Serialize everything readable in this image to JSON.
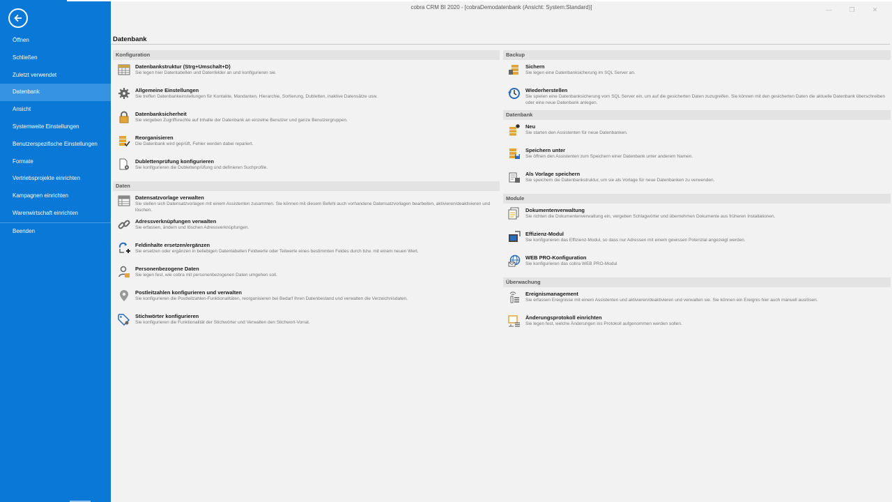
{
  "window": {
    "title": "cobra CRM BI 2020 - [cobraDemodatenbank (Ansicht: System:Standard)]",
    "controls": [
      "—",
      "❐",
      "✕"
    ]
  },
  "sidebar": {
    "items": [
      {
        "label": "Öffnen"
      },
      {
        "label": "Schließen"
      },
      {
        "label": "Zuletzt verwendet"
      },
      {
        "label": "Datenbank"
      },
      {
        "label": "Ansicht"
      },
      {
        "label": "Systemweite Einstellungen"
      },
      {
        "label": "Benutzerspezifische Einstellungen"
      },
      {
        "label": "Formate"
      },
      {
        "label": "Vertriebsprojekte einrichten"
      },
      {
        "label": "Kampagnen einrichten"
      },
      {
        "label": "Warenwirtschaft einrichten"
      },
      {
        "label": "Beenden"
      }
    ]
  },
  "page": {
    "title": "Datenbank"
  },
  "left": {
    "konfiguration": {
      "heading": "Konfiguration",
      "items": [
        {
          "title": "Datenbankstruktur (Strg+Umschalt+D)",
          "desc": "Sie legen hier Datentabellen und Datenfelder an und konfigurieren sie."
        },
        {
          "title": "Allgemeine Einstellungen",
          "desc": "Sie treffen Datenbankeinstellungen für Kontakte, Mandanten, Hierarchie, Sortierung, Dubletten, inaktive Datensätze usw."
        },
        {
          "title": "Datenbanksicherheit",
          "desc": "Sie vergeben Zugriffsrechte auf Inhalte der Datenbank an einzelne Benutzer und ganze Benutzergruppen."
        },
        {
          "title": "Reorganisieren",
          "desc": "Die Datenbank wird geprüft, Fehler werden dabei repariert."
        },
        {
          "title": "Dublettenprüfung konfigurieren",
          "desc": "Sie konfigurieren die Dublettenprüfung und definieren Suchprofile."
        }
      ]
    },
    "daten": {
      "heading": "Daten",
      "items": [
        {
          "title": "Datensatzvorlage verwalten",
          "desc": "Sie stellen sich Datensatzvorlagen mit einem Assistenten zusammen. Sie können mit diesem Befehl auch vorhandene Datensatzvorlagen bearbeiten, aktivieren/deaktivieren und löschen."
        },
        {
          "title": "Adressverknüpfungen verwalten",
          "desc": "Sie erfassen, ändern und löschen Adressverknüpfungen."
        },
        {
          "title": "Feldinhalte ersetzen/ergänzen",
          "desc": "Sie ersetzen oder ergänzen in beliebigen Datentabellen Feldwerte oder Teilwerte eines bestimmten Feldes durch bzw. mit einem neuen Wert."
        },
        {
          "title": "Personenbezogene Daten",
          "desc": "Sie legen fest, wie cobra mit personenbezogenen Daten umgehen soll."
        },
        {
          "title": "Postleitzahlen konfigurieren und verwalten",
          "desc": "Sie konfigurieren die Postleitzahlen-Funktionalitäten, reorganisieren bei Bedarf Ihren Datenbestand und verwalten die Verzeichnisdaten."
        },
        {
          "title": "Stichwörter konfigurieren",
          "desc": "Sie konfigurieren die Funktionalität der Stichwörter und Verwalten den Stichwort-Vorrat."
        }
      ]
    }
  },
  "right": {
    "backup": {
      "heading": "Backup",
      "items": [
        {
          "title": "Sichern",
          "desc": "Sie legen eine Datenbanksicherung im SQL Server an."
        },
        {
          "title": "Wiederherstellen",
          "desc": "Sie spielen eine Datenbanksicherung vom SQL Server ein, um auf die gesicherten Daten zuzugreifen. Sie können mit den gesicherten Daten die aktuelle Datenbank überschreiben oder eine neue Datenbank anlegen."
        }
      ]
    },
    "datenbank": {
      "heading": "Datenbank",
      "items": [
        {
          "title": "Neu",
          "desc": "Sie starten den Assistenten für neue Datenbanken."
        },
        {
          "title": "Speichern unter",
          "desc": "Sie öffnen den Assistenten zum Speichern einer Datenbank unter anderem Namen."
        },
        {
          "title": "Als Vorlage speichern",
          "desc": "Sie speichern die Datenbankstruktur, um sie als Vorlage für neue Datenbanken zu verwenden."
        }
      ]
    },
    "module": {
      "heading": "Module",
      "items": [
        {
          "title": "Dokumentenverwaltung",
          "desc": "Sie richten die Dokumentenverwaltung ein, vergeben Schlagwörter und übernehmen Dokumente aus früheren Installationen."
        },
        {
          "title": "Effizienz-Modul",
          "desc": "Sie konfigurieren das Effizienz-Modul, so dass nur Adressen mit einem gewissen Potenzial angezeigt werden."
        },
        {
          "title": "WEB PRO-Konfiguration",
          "desc": "Sie konfigurieren das cobra WEB PRO-Modul"
        }
      ]
    },
    "ueberwachung": {
      "heading": "Überwachung",
      "items": [
        {
          "title": "Ereignismanagement",
          "desc": "Sie erfassen Ereignisse mit einem Assistenten und aktivieren/deaktivieren und verwalten sie. Sie können ein Ereignis hier auch manuell auslösen."
        },
        {
          "title": "Änderungsprotokoll einrichten",
          "desc": "Sie legen fest, welche Änderungen ins Protokoll aufgenommen werden sollen."
        }
      ]
    }
  }
}
